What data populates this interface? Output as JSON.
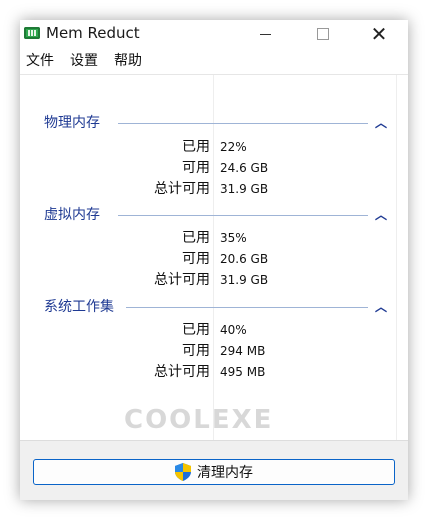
{
  "window": {
    "title": "Mem Reduct"
  },
  "menu": [
    "文件",
    "设置",
    "帮助"
  ],
  "groups": [
    {
      "title": "物理内存",
      "rows": [
        {
          "label": "已用",
          "value": "22%"
        },
        {
          "label": "可用",
          "value": "24.6 GB"
        },
        {
          "label": "总计可用",
          "value": "31.9 GB"
        }
      ]
    },
    {
      "title": "虚拟内存",
      "rows": [
        {
          "label": "已用",
          "value": "35%"
        },
        {
          "label": "可用",
          "value": "20.6 GB"
        },
        {
          "label": "总计可用",
          "value": "31.9 GB"
        }
      ]
    },
    {
      "title": "系统工作集",
      "rows": [
        {
          "label": "已用",
          "value": "40%"
        },
        {
          "label": "可用",
          "value": "294 MB"
        },
        {
          "label": "总计可用",
          "value": "495 MB"
        }
      ]
    }
  ],
  "watermark": "COOLEXE",
  "footer": {
    "clean_button": "清理内存"
  },
  "icons": {
    "app": "memory-chip-icon",
    "shield": "uac-shield-icon",
    "collapse": "chevron-up-icon"
  },
  "colors": {
    "group_title": "#1f3a93",
    "button_border": "#0a64c8"
  }
}
